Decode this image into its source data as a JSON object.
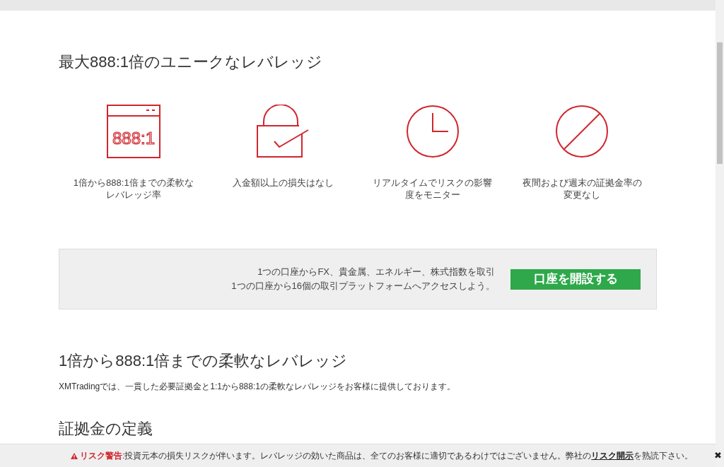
{
  "heading": "最大888:1倍のユニークなレバレッジ",
  "features": [
    {
      "kind": "calculator",
      "icon_text": "888:1",
      "caption": [
        "1倍から888:1倍までの柔軟な",
        "レバレッジ率"
      ]
    },
    {
      "kind": "lock",
      "caption": [
        "入金額以上の損失はなし"
      ]
    },
    {
      "kind": "clock",
      "caption": [
        "リアルタイムでリスクの影響",
        "度をモニター"
      ]
    },
    {
      "kind": "prohibited",
      "caption": [
        "夜間および週末の証拠金率の",
        "変更なし"
      ]
    }
  ],
  "banner": {
    "lines": [
      "1つの口座からFX、貴金属、エネルギー、株式指数を取引",
      "1つの口座から16個の取引プラットフォームへアクセスしよう。"
    ],
    "button": "口座を開設する"
  },
  "section_title": "1倍から888:1倍までの柔軟なレバレッジ",
  "section_text": "XMTradingでは、一貫した必要証拠金と1:1から888:1の柔軟なレバレッジをお客様に提供しております。",
  "next_title": "証拠金の定義",
  "risk_warning": {
    "label": "リスク警告",
    "text_before": ":投資元本の損失リスクが伴います。レバレッジの効いた商品は、全てのお客様に適切であるわけではございません。弊社の",
    "link": "リスク開示",
    "text_after": "を熟読下さい。",
    "close": "✖"
  }
}
